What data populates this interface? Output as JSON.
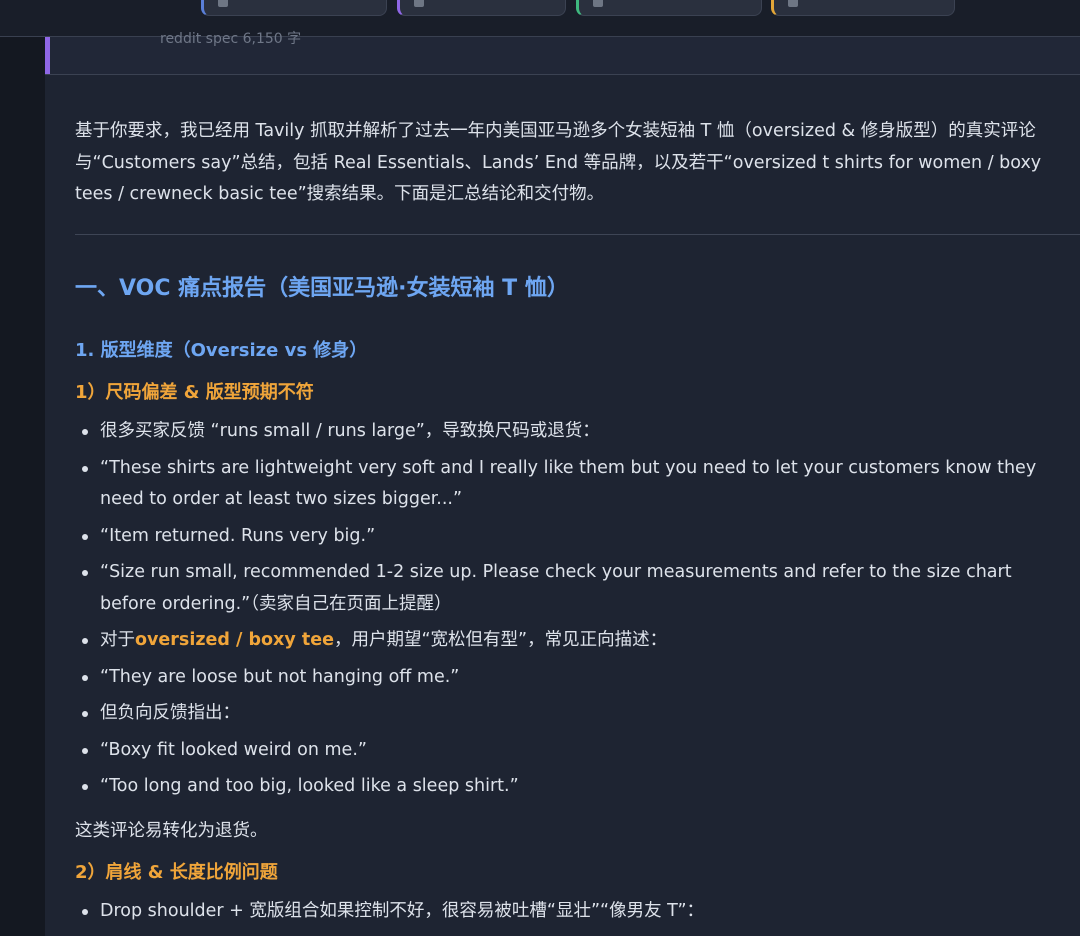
{
  "top_chips": [
    {
      "label": "",
      "accent": "#5a7fd8"
    },
    {
      "label": "",
      "accent": "#8f67e6"
    },
    {
      "label": "",
      "accent": "#3fb97f"
    },
    {
      "label": "",
      "accent": "#e3a638"
    }
  ],
  "quote": {
    "text": "reddit spec 6,150 字"
  },
  "intro": "基于你要求，我已经用 Tavily 抓取并解析了过去一年内美国亚马逊多个女装短袖 T 恤（oversized & 修身版型）的真实评论与“Customers say”总结，包括 Real Essentials、Lands’ End 等品牌，以及若干“oversized t shirts for women / boxy tees / crewneck basic tee”搜索结果。下面是汇总结论和交付物。",
  "section1": {
    "title": "一、VOC 痛点报告（美国亚马逊·女装短袖 T 恤）",
    "sub1": {
      "title": "1. 版型维度（Oversize vs 修身）",
      "point1": {
        "title": "1）尺码偏差 & 版型预期不符",
        "items": [
          {
            "text": "很多买家反馈 “runs small / runs large”，导致换尺码或退货："
          },
          {
            "text": "“These shirts are lightweight very soft and I really like them but you need to let your customers know they need to order at least two sizes bigger...”"
          },
          {
            "text": "“Item returned. Runs very big.”"
          },
          {
            "text": "“Size run small, recommended 1-2 size up. Please check your measurements and refer to the size chart before ordering.”（卖家自己在页面上提醒）"
          },
          {
            "prefix": "对于",
            "highlight": "oversized / boxy tee",
            "suffix": "，用户期望“宽松但有型”，常见正向描述："
          },
          {
            "text": "“They are loose but not hanging off me.”"
          },
          {
            "text": "但负向反馈指出："
          },
          {
            "text": "“Boxy fit looked weird on me.”"
          },
          {
            "text": "“Too long and too big, looked like a sleep shirt.”"
          }
        ],
        "conclusion": "这类评论易转化为退货。"
      },
      "point2": {
        "title": "2）肩线 & 长度比例问题",
        "items": [
          {
            "text": "Drop shoulder + 宽版组合如果控制不好，很容易被吐槽“显壮”“像男友 T”："
          }
        ]
      }
    }
  }
}
